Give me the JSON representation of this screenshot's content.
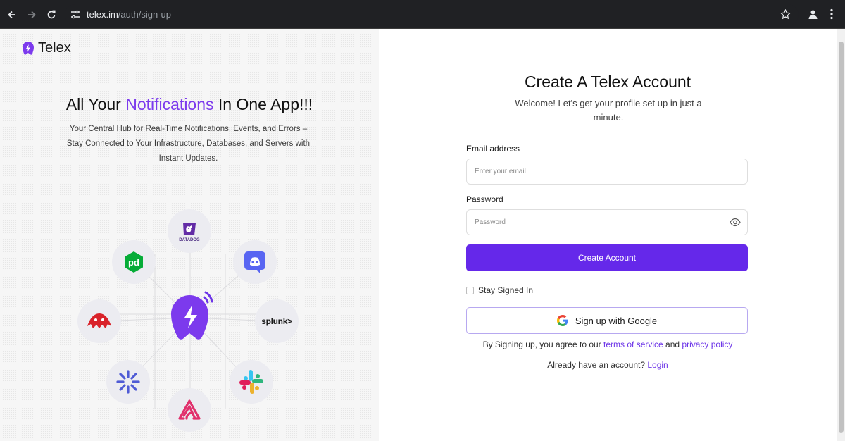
{
  "browser": {
    "url_host": "telex.im",
    "url_path": "/auth/sign-up"
  },
  "brand": {
    "name": "Telex",
    "accent": "#7c3aed",
    "button": "#6528ea"
  },
  "hero": {
    "headline_start": "All Your ",
    "headline_accent": "Notifications",
    "headline_end": " In One App!!!",
    "subline": "Your Central Hub for Real-Time Notifications, Events, and Errors – Stay Connected to Your Infrastructure, Databases, and Servers with Instant Updates."
  },
  "integrations": {
    "datadog_label": "DATADOG",
    "splunk_label": "splunk>",
    "pagerduty_label": "pd",
    "icons": [
      "datadog-icon",
      "discord-icon",
      "splunk-icon",
      "slack-icon",
      "sentry-icon",
      "asterisk-icon",
      "redis-bird-icon",
      "pagerduty-icon",
      "telex-bell-icon"
    ]
  },
  "form": {
    "title": "Create A Telex Account",
    "welcome": "Welcome! Let's get your profile set up in just a minute.",
    "email_label": "Email address",
    "email_placeholder": "Enter your email",
    "password_label": "Password",
    "password_placeholder": "Password",
    "submit_label": "Create Account",
    "stay_signed_in": "Stay Signed In",
    "google_label": "Sign up with Google",
    "terms_prefix": "By Signing up, you agree to our ",
    "terms_link": "terms of service",
    "terms_and": " and ",
    "privacy_link": "privacy policy",
    "already_prefix": "Already have an account? ",
    "login_link": "Login"
  }
}
